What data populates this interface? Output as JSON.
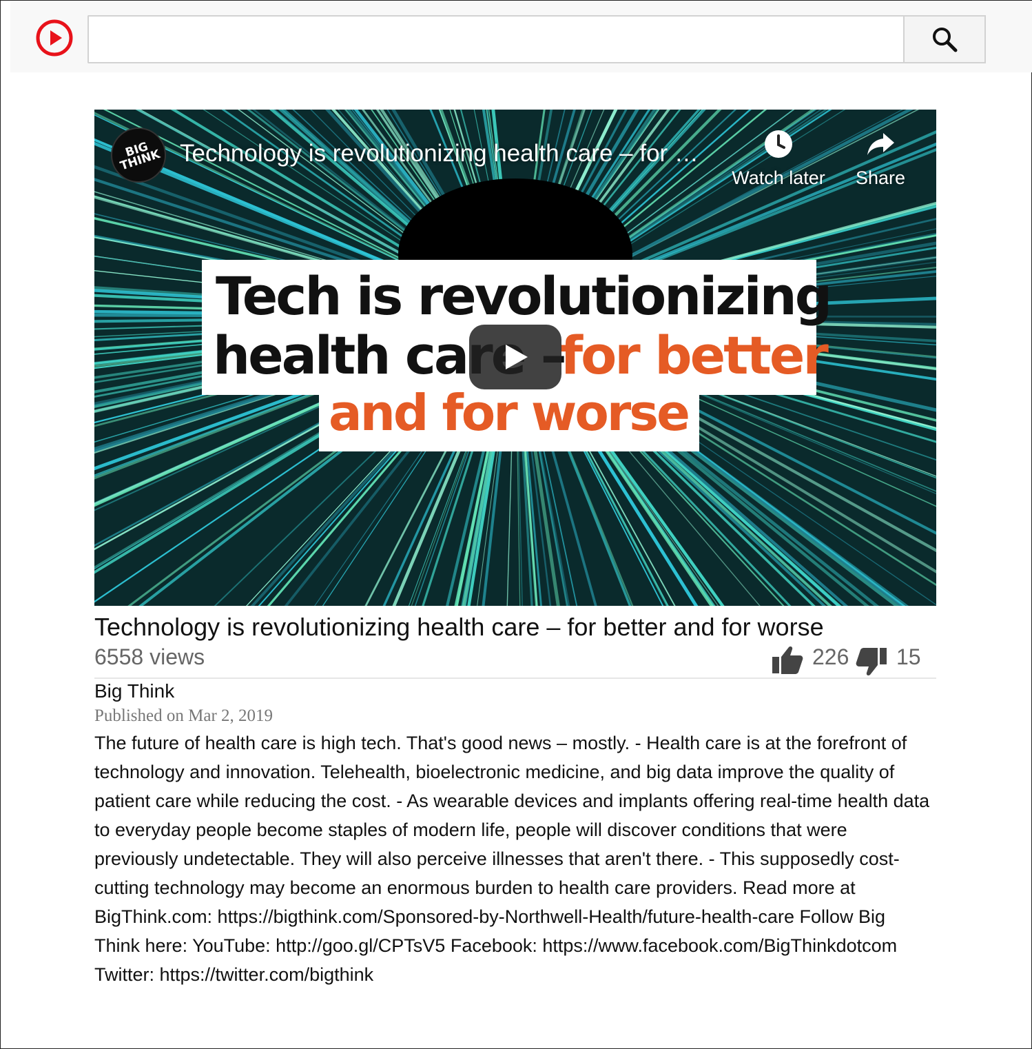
{
  "header": {
    "logo_icon": "play-circle-icon",
    "search_placeholder": "",
    "search_button_icon": "search-icon"
  },
  "player": {
    "channel_avatar_text": "BIG THINK",
    "title": "Technology is revolutionizing health care – for …",
    "watch_later_label": "Watch later",
    "share_label": "Share",
    "thumbnail_text": {
      "line1": "Tech is revolutionizing",
      "line2_black": "health care –",
      "line2_orange": "for better",
      "line3": "and for worse"
    },
    "play_button_icon": "play-icon",
    "thumbnail_colors": {
      "accent": "#e55b25",
      "ray": "#3fd0c0"
    }
  },
  "video": {
    "title": "Technology is revolutionizing health care – for better and for worse",
    "views": "6558 views",
    "likes": "226",
    "dislikes": "15",
    "channel": "Big Think",
    "published": "Published on Mar 2, 2019",
    "description": "The future of health care is high tech. That's good news – mostly. - Health care is at the forefront of technology and innovation. Telehealth, bioelectronic medicine, and big data improve the quality of patient care while reducing the cost. - As wearable devices and implants offering real-time health data to everyday people become staples of modern life, people will discover conditions that were previously undetectable. They will also perceive illnesses that aren't there. - This supposedly cost-cutting technology may become an enormous burden to health care providers. Read more at BigThink.com: https://bigthink.com/Sponsored-by-Northwell-Health/future-health-care Follow Big Think here: YouTube: http://goo.gl/CPTsV5 Facebook: https://www.facebook.com/BigThinkdotcom Twitter: https://twitter.com/bigthink"
  }
}
